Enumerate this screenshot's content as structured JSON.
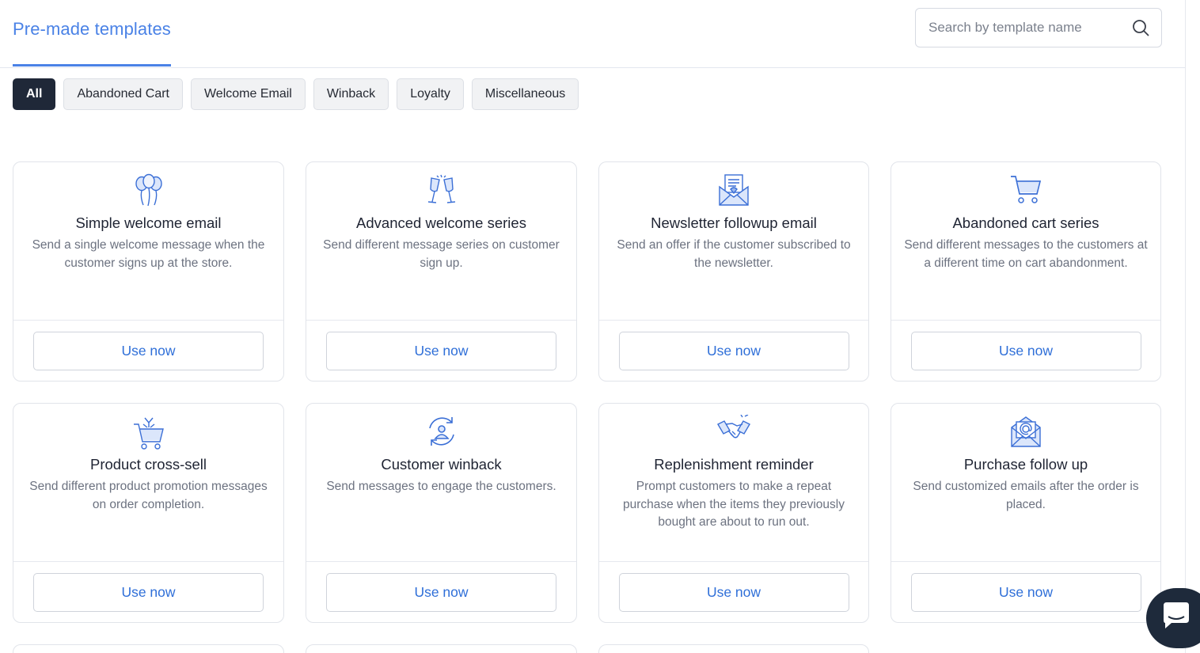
{
  "header": {
    "title": "Pre-made templates",
    "search_placeholder": "Search by template name"
  },
  "filters": [
    "All",
    "Abandoned Cart",
    "Welcome Email",
    "Winback",
    "Loyalty",
    "Miscellaneous"
  ],
  "active_filter": "All",
  "templates": [
    {
      "icon": "balloons-icon",
      "title": "Simple welcome email",
      "description": "Send a single welcome message when the customer signs up at the store.",
      "button": "Use now"
    },
    {
      "icon": "champagne-glasses-icon",
      "title": "Advanced welcome series",
      "description": "Send different message series on customer sign up.",
      "button": "Use now"
    },
    {
      "icon": "newsletter-envelope-icon",
      "title": "Newsletter followup email",
      "description": "Send an offer if the customer subscribed to the newsletter.",
      "button": "Use now"
    },
    {
      "icon": "shopping-cart-icon",
      "title": "Abandoned cart series",
      "description": "Send different messages to the customers at a different time on cart abandonment.",
      "button": "Use now"
    },
    {
      "icon": "cart-cross-sell-icon",
      "title": "Product cross-sell",
      "description": "Send different product promotion messages on order completion.",
      "button": "Use now"
    },
    {
      "icon": "customer-refresh-icon",
      "title": "Customer winback",
      "description": "Send messages to engage the customers.",
      "button": "Use now"
    },
    {
      "icon": "handshake-icon",
      "title": "Replenishment reminder",
      "description": "Prompt customers to make a repeat purchase when the items they previously bought are about to run out.",
      "button": "Use now"
    },
    {
      "icon": "email-at-envelope-icon",
      "title": "Purchase follow up",
      "description": "Send customized emails after the order is placed.",
      "button": "Use now"
    }
  ],
  "colors": {
    "accent": "#4a82e6",
    "button_text": "#2f6fd8",
    "active_chip": "#1f2838",
    "icon": "#3b6fd6",
    "chat_button": "#1e2a3b"
  },
  "chat": {
    "icon": "chat-bubble-icon"
  }
}
